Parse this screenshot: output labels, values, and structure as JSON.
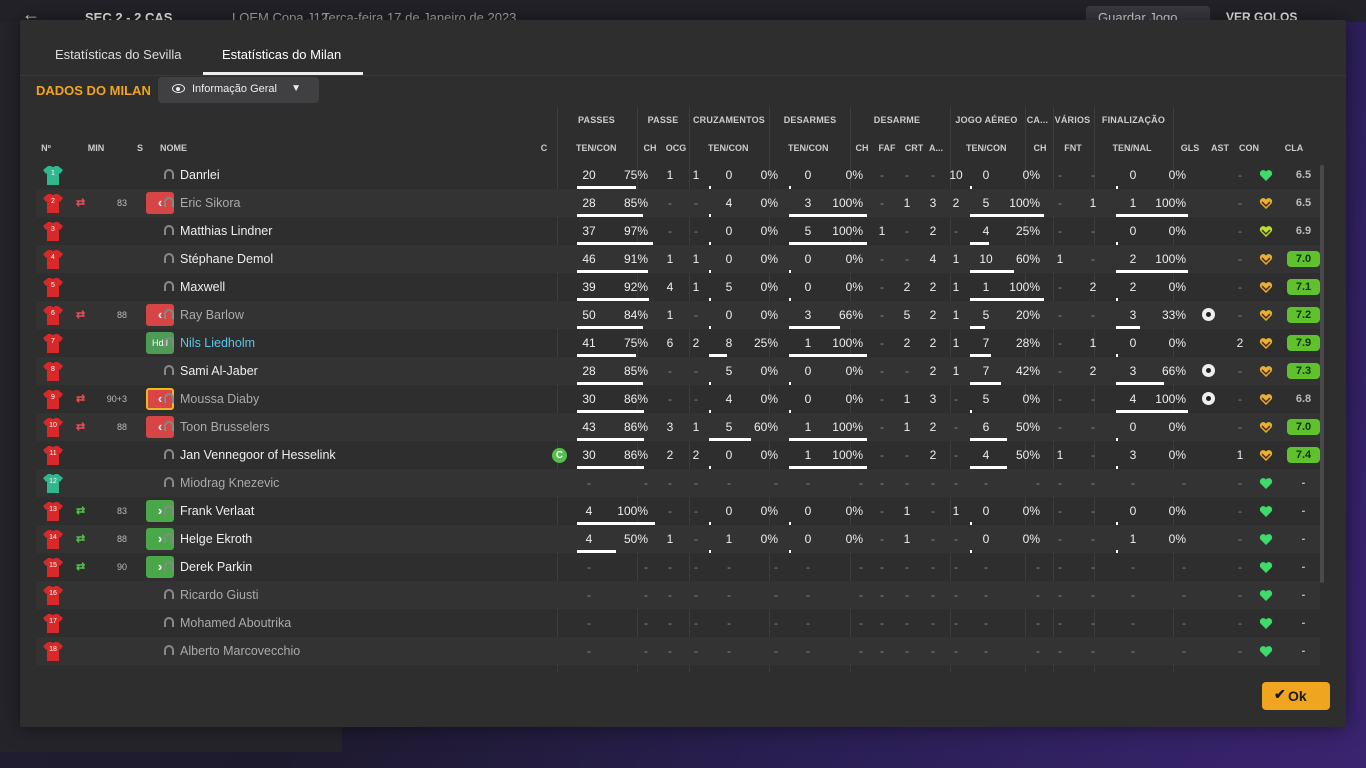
{
  "topbar": {
    "back_icon": "←",
    "score": "SEC  2 - 2  CAS",
    "competition": "LOEM Copa J12",
    "date": "Terça-feira 17 de Janeiro de 2023",
    "save_label": "Guardar Jogo",
    "goals_label": "VER GOLOS"
  },
  "tabs": [
    {
      "label": "Estatísticas do Sevilla"
    },
    {
      "label": "Estatísticas do Milan"
    }
  ],
  "title": "DADOS DO MILAN",
  "view_select": "Informação Geral",
  "groups": [
    "PASSES",
    "PASSE",
    "CRUZAMENTOS",
    "DESARMES",
    "DESARME",
    "JOGO AÉREO",
    "CA...",
    "VÁRIOS",
    "FINALIZAÇÃO"
  ],
  "columns": [
    "Nº",
    "MIN",
    "S",
    "NOME",
    "C",
    "TEN/CON",
    "CH",
    "OCG",
    "TEN/CON",
    "TEN/CON",
    "CH",
    "FAF",
    "CRT",
    "A...",
    "TEN/CON",
    "CH",
    "FNT",
    "TEN/NAL",
    "GLS",
    "AST",
    "CON",
    "CLA"
  ],
  "ok_label": "Ok",
  "ok_icon": "✔",
  "colors": {
    "accent": "#f0a520",
    "sub_out": "#d84545",
    "sub_in": "#4aa84a",
    "rating": "#5fc22c",
    "link": "#5bc4e6"
  },
  "players": [
    {
      "num": "1",
      "gk": true,
      "min": "",
      "swap": "",
      "s": "",
      "name": "Danrlei",
      "style": "",
      "c": "",
      "pas": [
        "20",
        "75%"
      ],
      "ch": "1",
      "ocg": "1",
      "cru": [
        "0",
        "0%"
      ],
      "des": [
        "0",
        "0%"
      ],
      "d": [
        "-",
        "-",
        "-",
        "10"
      ],
      "aer": [
        "0",
        "0%"
      ],
      "ca": "-",
      "fnt": "-",
      "fin": [
        "0",
        "0%"
      ],
      "gls": false,
      "ast": "-",
      "con": "green",
      "cla": "6.5",
      "cla_g": false
    },
    {
      "num": "2",
      "gk": false,
      "min": "83",
      "swap": "out",
      "s": "out",
      "name": "Eric Sikora",
      "style": "dim",
      "c": "",
      "pas": [
        "28",
        "85%"
      ],
      "ch": "-",
      "ocg": "-",
      "cru": [
        "4",
        "0%"
      ],
      "des": [
        "3",
        "100%"
      ],
      "d": [
        "-",
        "1",
        "3",
        "2"
      ],
      "aer": [
        "5",
        "100%"
      ],
      "ca": "-",
      "fnt": "1",
      "fin": [
        "1",
        "100%"
      ],
      "gls": false,
      "ast": "-",
      "con": "yellow",
      "cla": "6.5",
      "cla_g": false
    },
    {
      "num": "3",
      "gk": false,
      "min": "",
      "swap": "",
      "s": "",
      "name": "Matthias Lindner",
      "style": "",
      "c": "",
      "pas": [
        "37",
        "97%"
      ],
      "ch": "-",
      "ocg": "-",
      "cru": [
        "0",
        "0%"
      ],
      "des": [
        "5",
        "100%"
      ],
      "d": [
        "1",
        "-",
        "2",
        "-"
      ],
      "aer": [
        "4",
        "25%"
      ],
      "ca": "-",
      "fnt": "-",
      "fin": [
        "0",
        "0%"
      ],
      "gls": false,
      "ast": "-",
      "con": "lime",
      "cla": "6.9",
      "cla_g": false
    },
    {
      "num": "4",
      "gk": false,
      "min": "",
      "swap": "",
      "s": "",
      "name": "Stéphane Demol",
      "style": "",
      "c": "",
      "pas": [
        "46",
        "91%"
      ],
      "ch": "1",
      "ocg": "1",
      "cru": [
        "0",
        "0%"
      ],
      "des": [
        "0",
        "0%"
      ],
      "d": [
        "-",
        "-",
        "4",
        "1"
      ],
      "aer": [
        "10",
        "60%"
      ],
      "ca": "1",
      "fnt": "-",
      "fin": [
        "2",
        "100%"
      ],
      "gls": false,
      "ast": "-",
      "con": "yellow",
      "cla": "7.0",
      "cla_g": true
    },
    {
      "num": "5",
      "gk": false,
      "min": "",
      "swap": "",
      "s": "",
      "name": "Maxwell",
      "style": "",
      "c": "",
      "pas": [
        "39",
        "92%"
      ],
      "ch": "4",
      "ocg": "1",
      "cru": [
        "5",
        "0%"
      ],
      "des": [
        "0",
        "0%"
      ],
      "d": [
        "-",
        "2",
        "2",
        "1"
      ],
      "aer": [
        "1",
        "100%"
      ],
      "ca": "-",
      "fnt": "2",
      "fin": [
        "2",
        "0%"
      ],
      "gls": false,
      "ast": "-",
      "con": "yellow",
      "cla": "7.1",
      "cla_g": true
    },
    {
      "num": "6",
      "gk": false,
      "min": "88",
      "swap": "out",
      "s": "out",
      "name": "Ray Barlow",
      "style": "dim",
      "c": "",
      "pas": [
        "50",
        "84%"
      ],
      "ch": "1",
      "ocg": "-",
      "cru": [
        "0",
        "0%"
      ],
      "des": [
        "3",
        "66%"
      ],
      "d": [
        "-",
        "5",
        "2",
        "1"
      ],
      "aer": [
        "5",
        "20%"
      ],
      "ca": "-",
      "fnt": "-",
      "fin": [
        "3",
        "33%"
      ],
      "gls": true,
      "ast": "-",
      "con": "yellow",
      "cla": "7.2",
      "cla_g": true
    },
    {
      "num": "7",
      "gk": false,
      "min": "",
      "swap": "",
      "s": "hdj",
      "name": "Nils Liedholm",
      "style": "hl",
      "c": "",
      "pas": [
        "41",
        "75%"
      ],
      "ch": "6",
      "ocg": "2",
      "cru": [
        "8",
        "25%"
      ],
      "des": [
        "1",
        "100%"
      ],
      "d": [
        "-",
        "2",
        "2",
        "1"
      ],
      "aer": [
        "7",
        "28%"
      ],
      "ca": "-",
      "fnt": "1",
      "fin": [
        "0",
        "0%"
      ],
      "gls": false,
      "ast": "2",
      "con": "yellow",
      "cla": "7.9",
      "cla_g": true
    },
    {
      "num": "8",
      "gk": false,
      "min": "",
      "swap": "",
      "s": "",
      "name": "Sami Al-Jaber",
      "style": "",
      "c": "",
      "pas": [
        "28",
        "85%"
      ],
      "ch": "-",
      "ocg": "-",
      "cru": [
        "5",
        "0%"
      ],
      "des": [
        "0",
        "0%"
      ],
      "d": [
        "-",
        "-",
        "2",
        "1"
      ],
      "aer": [
        "7",
        "42%"
      ],
      "ca": "-",
      "fnt": "2",
      "fin": [
        "3",
        "66%"
      ],
      "gls": true,
      "ast": "-",
      "con": "yellow",
      "cla": "7.3",
      "cla_g": true
    },
    {
      "num": "9",
      "gk": false,
      "min": "90+3",
      "swap": "out",
      "s": "out-yel",
      "name": "Moussa Diaby",
      "style": "dim",
      "c": "",
      "pas": [
        "30",
        "86%"
      ],
      "ch": "-",
      "ocg": "-",
      "cru": [
        "4",
        "0%"
      ],
      "des": [
        "0",
        "0%"
      ],
      "d": [
        "-",
        "1",
        "3",
        "-"
      ],
      "aer": [
        "5",
        "0%"
      ],
      "ca": "-",
      "fnt": "-",
      "fin": [
        "4",
        "100%"
      ],
      "gls": true,
      "ast": "-",
      "con": "yellow",
      "cla": "6.8",
      "cla_g": false
    },
    {
      "num": "10",
      "gk": false,
      "min": "88",
      "swap": "out",
      "s": "out",
      "name": "Toon Brusselers",
      "style": "dim",
      "c": "",
      "pas": [
        "43",
        "86%"
      ],
      "ch": "3",
      "ocg": "1",
      "cru": [
        "5",
        "60%"
      ],
      "des": [
        "1",
        "100%"
      ],
      "d": [
        "-",
        "1",
        "2",
        "-"
      ],
      "aer": [
        "6",
        "50%"
      ],
      "ca": "-",
      "fnt": "-",
      "fin": [
        "0",
        "0%"
      ],
      "gls": false,
      "ast": "-",
      "con": "yellow",
      "cla": "7.0",
      "cla_g": true
    },
    {
      "num": "11",
      "gk": false,
      "min": "",
      "swap": "",
      "s": "",
      "name": "Jan Vennegoor of Hesselink",
      "style": "",
      "c": "C",
      "pas": [
        "30",
        "86%"
      ],
      "ch": "2",
      "ocg": "2",
      "cru": [
        "0",
        "0%"
      ],
      "des": [
        "1",
        "100%"
      ],
      "d": [
        "-",
        "-",
        "2",
        "-"
      ],
      "aer": [
        "4",
        "50%"
      ],
      "ca": "1",
      "fnt": "-",
      "fin": [
        "3",
        "0%"
      ],
      "gls": false,
      "ast": "1",
      "con": "yellow",
      "cla": "7.4",
      "cla_g": true
    },
    {
      "num": "12",
      "gk": true,
      "min": "",
      "swap": "",
      "s": "",
      "name": "Miodrag Knezevic",
      "style": "dim",
      "c": "",
      "pas": [
        "-",
        "-"
      ],
      "ch": "-",
      "ocg": "-",
      "cru": [
        "-",
        "-"
      ],
      "des": [
        "-",
        "-"
      ],
      "d": [
        "-",
        "-",
        "-",
        "-"
      ],
      "aer": [
        "-",
        "-"
      ],
      "ca": "-",
      "fnt": "-",
      "fin": [
        "-",
        "-"
      ],
      "gls": false,
      "ast": "-",
      "con": "green",
      "cla": "-",
      "cla_g": false
    },
    {
      "num": "13",
      "gk": false,
      "min": "83",
      "swap": "in",
      "s": "in",
      "name": "Frank Verlaat",
      "style": "",
      "c": "",
      "pas": [
        "4",
        "100%"
      ],
      "ch": "-",
      "ocg": "-",
      "cru": [
        "0",
        "0%"
      ],
      "des": [
        "0",
        "0%"
      ],
      "d": [
        "-",
        "1",
        "-",
        "1"
      ],
      "aer": [
        "0",
        "0%"
      ],
      "ca": "-",
      "fnt": "-",
      "fin": [
        "0",
        "0%"
      ],
      "gls": false,
      "ast": "-",
      "con": "green",
      "cla": "-",
      "cla_g": false
    },
    {
      "num": "14",
      "gk": false,
      "min": "88",
      "swap": "in",
      "s": "in",
      "name": "Helge Ekroth",
      "style": "",
      "c": "",
      "pas": [
        "4",
        "50%"
      ],
      "ch": "1",
      "ocg": "-",
      "cru": [
        "1",
        "0%"
      ],
      "des": [
        "0",
        "0%"
      ],
      "d": [
        "-",
        "1",
        "-",
        "-"
      ],
      "aer": [
        "0",
        "0%"
      ],
      "ca": "-",
      "fnt": "-",
      "fin": [
        "1",
        "0%"
      ],
      "gls": false,
      "ast": "-",
      "con": "green",
      "cla": "-",
      "cla_g": false
    },
    {
      "num": "15",
      "gk": false,
      "min": "90",
      "swap": "in",
      "s": "in",
      "name": "Derek Parkin",
      "style": "",
      "c": "",
      "pas": [
        "-",
        "-"
      ],
      "ch": "-",
      "ocg": "-",
      "cru": [
        "-",
        "-"
      ],
      "des": [
        "-",
        "-"
      ],
      "d": [
        "-",
        "-",
        "-",
        "-"
      ],
      "aer": [
        "-",
        "-"
      ],
      "ca": "-",
      "fnt": "-",
      "fin": [
        "-",
        "-"
      ],
      "gls": false,
      "ast": "-",
      "con": "green",
      "cla": "-",
      "cla_g": false
    },
    {
      "num": "16",
      "gk": false,
      "min": "",
      "swap": "",
      "s": "",
      "name": "Ricardo Giusti",
      "style": "dim",
      "c": "",
      "pas": [
        "-",
        "-"
      ],
      "ch": "-",
      "ocg": "-",
      "cru": [
        "-",
        "-"
      ],
      "des": [
        "-",
        "-"
      ],
      "d": [
        "-",
        "-",
        "-",
        "-"
      ],
      "aer": [
        "-",
        "-"
      ],
      "ca": "-",
      "fnt": "-",
      "fin": [
        "-",
        "-"
      ],
      "gls": false,
      "ast": "-",
      "con": "green",
      "cla": "-",
      "cla_g": false
    },
    {
      "num": "17",
      "gk": false,
      "min": "",
      "swap": "",
      "s": "",
      "name": "Mohamed Aboutrika",
      "style": "dim",
      "c": "",
      "pas": [
        "-",
        "-"
      ],
      "ch": "-",
      "ocg": "-",
      "cru": [
        "-",
        "-"
      ],
      "des": [
        "-",
        "-"
      ],
      "d": [
        "-",
        "-",
        "-",
        "-"
      ],
      "aer": [
        "-",
        "-"
      ],
      "ca": "-",
      "fnt": "-",
      "fin": [
        "-",
        "-"
      ],
      "gls": false,
      "ast": "-",
      "con": "green",
      "cla": "-",
      "cla_g": false
    },
    {
      "num": "18",
      "gk": false,
      "min": "",
      "swap": "",
      "s": "",
      "name": "Alberto Marcovecchio",
      "style": "dim",
      "c": "",
      "pas": [
        "-",
        "-"
      ],
      "ch": "-",
      "ocg": "-",
      "cru": [
        "-",
        "-"
      ],
      "des": [
        "-",
        "-"
      ],
      "d": [
        "-",
        "-",
        "-",
        "-"
      ],
      "aer": [
        "-",
        "-"
      ],
      "ca": "-",
      "fnt": "-",
      "fin": [
        "-",
        "-"
      ],
      "gls": false,
      "ast": "-",
      "con": "green",
      "cla": "-",
      "cla_g": false
    }
  ]
}
